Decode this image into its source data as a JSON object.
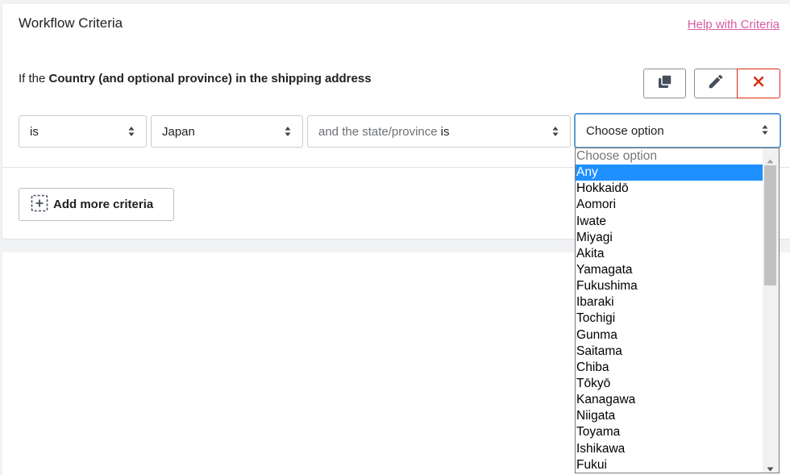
{
  "card": {
    "title": "Workflow Criteria",
    "help_link": "Help with Criteria",
    "criteria_prefix": "If the",
    "criteria_field": "Country (and optional province) in the shipping address"
  },
  "actions": {
    "copy_icon": "copy-icon",
    "edit_icon": "pencil-icon",
    "delete_icon": "close-icon",
    "delete_color": "#d82c0d"
  },
  "condition": {
    "operator": "is",
    "country": "Japan",
    "mode_text": "and the state/province",
    "mode_is": "is",
    "state_value": "Choose option"
  },
  "add_criteria": {
    "label": "Add more criteria",
    "icon": "add-dashed-icon"
  },
  "dropdown": {
    "selected": "Any",
    "options": [
      "Choose option",
      "Any",
      "Hokkaidō",
      "Aomori",
      "Iwate",
      "Miyagi",
      "Akita",
      "Yamagata",
      "Fukushima",
      "Ibaraki",
      "Tochigi",
      "Gunma",
      "Saitama",
      "Chiba",
      "Tōkyō",
      "Kanagawa",
      "Niigata",
      "Toyama",
      "Ishikawa",
      "Fukui"
    ],
    "highlight_color": "#1e90ff"
  },
  "colors": {
    "link": "#d75ba3",
    "focus_border": "#5b9bd5"
  }
}
